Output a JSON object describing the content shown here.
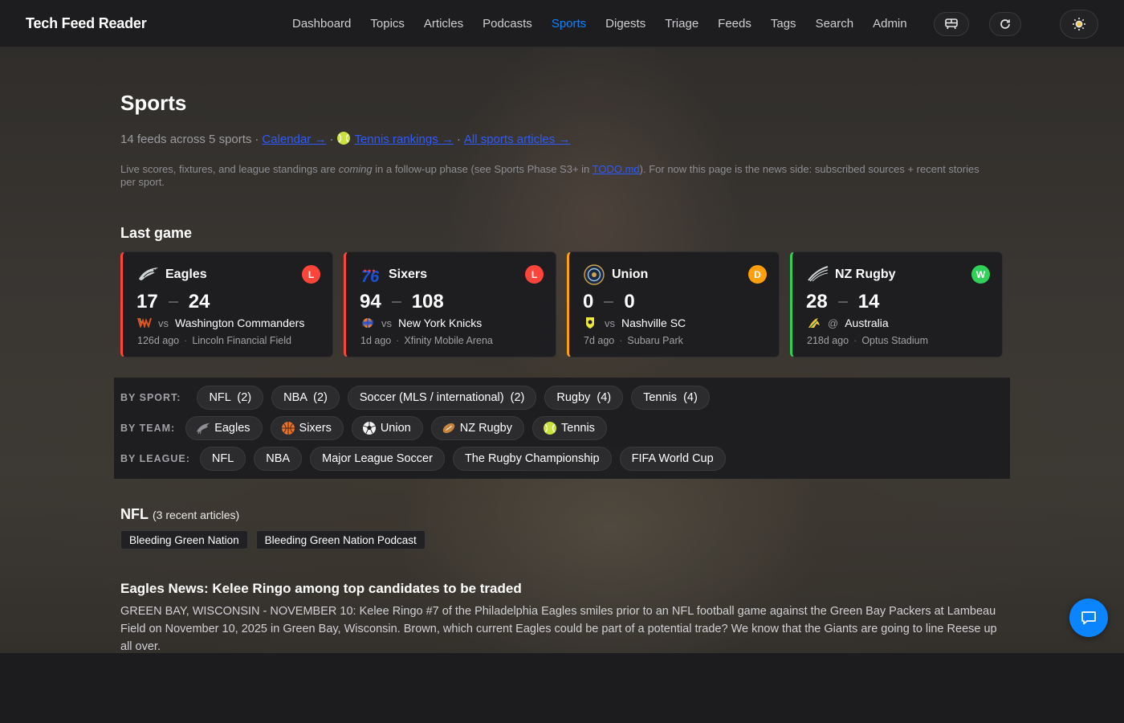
{
  "app": {
    "title": "Tech Feed Reader"
  },
  "nav": {
    "items": [
      {
        "label": "Dashboard"
      },
      {
        "label": "Topics"
      },
      {
        "label": "Articles"
      },
      {
        "label": "Podcasts"
      },
      {
        "label": "Sports",
        "active": true
      },
      {
        "label": "Digests"
      },
      {
        "label": "Triage"
      },
      {
        "label": "Feeds"
      },
      {
        "label": "Tags"
      },
      {
        "label": "Search"
      },
      {
        "label": "Admin"
      }
    ],
    "icons": [
      "transit-icon",
      "refresh-icon",
      "sun-icon"
    ]
  },
  "page": {
    "title": "Sports",
    "summary_text": "14 feeds across 5 sports",
    "links": {
      "calendar": "Calendar →",
      "tennis": "Tennis rankings →",
      "all_sports": "All sports articles →"
    },
    "note": {
      "part1": "Live scores, fixtures, and league standings are ",
      "em": "coming",
      "part2": " in a follow-up phase (see Sports Phase S3+ in ",
      "link": "TODO.md",
      "part3": "). For now this page is the news side: subscribed sources + recent stories per sport."
    }
  },
  "last_game": {
    "title": "Last game",
    "cards": [
      {
        "team": "Eagles",
        "result": "L",
        "result_color": "#ff453a",
        "score_for": "17",
        "score_against": "24",
        "vs": "vs",
        "opponent": "Washington Commanders",
        "ago": "126d ago",
        "venue": "Lincoln Financial Field",
        "accent": "#ff453a"
      },
      {
        "team": "Sixers",
        "result": "L",
        "result_color": "#ff453a",
        "score_for": "94",
        "score_against": "108",
        "vs": "vs",
        "opponent": "New York Knicks",
        "ago": "1d ago",
        "venue": "Xfinity Mobile Arena",
        "accent": "#ff453a"
      },
      {
        "team": "Union",
        "result": "D",
        "result_color": "#ff9f0a",
        "score_for": "0",
        "score_against": "0",
        "vs": "vs",
        "opponent": "Nashville SC",
        "ago": "7d ago",
        "venue": "Subaru Park",
        "accent": "#ff9f0a"
      },
      {
        "team": "NZ Rugby",
        "result": "W",
        "result_color": "#30d158",
        "score_for": "28",
        "score_against": "14",
        "vs": "@",
        "opponent": "Australia",
        "ago": "218d ago",
        "venue": "Optus Stadium",
        "accent": "#30d158"
      }
    ]
  },
  "filters": {
    "by_sport": {
      "label": "BY SPORT:",
      "chips": [
        "NFL  (2)",
        "NBA  (2)",
        "Soccer (MLS / international)  (2)",
        "Rugby  (4)",
        "Tennis  (4)"
      ]
    },
    "by_team": {
      "label": "BY TEAM:",
      "chips": [
        "Eagles",
        "Sixers",
        "Union",
        "NZ Rugby",
        "Tennis"
      ]
    },
    "by_league": {
      "label": "BY LEAGUE:",
      "chips": [
        "NFL",
        "NBA",
        "Major League Soccer",
        "The Rugby Championship",
        "FIFA World Cup"
      ]
    }
  },
  "nfl": {
    "heading": "NFL",
    "count": "(3 recent articles)",
    "sources": [
      "Bleeding Green Nation",
      "Bleeding Green Nation Podcast"
    ],
    "article": {
      "title": "Eagles News: Kelee Ringo among top candidates to be traded",
      "body": "GREEN BAY, WISCONSIN - NOVEMBER 10: Kelee Ringo #7 of the Philadelphia Eagles smiles prior to an NFL football game against the Green Bay Packers at Lambeau Field on November 10, 2025 in Green Bay, Wisconsin. Brown, which current Eagles could be part of a potential trade? We know that the Giants are going to line Reese up all over."
    }
  },
  "colors": {
    "accent": "#0a84ff",
    "link": "#2d5bff",
    "loss": "#ff453a",
    "draw": "#ff9f0a",
    "win": "#30d158"
  }
}
